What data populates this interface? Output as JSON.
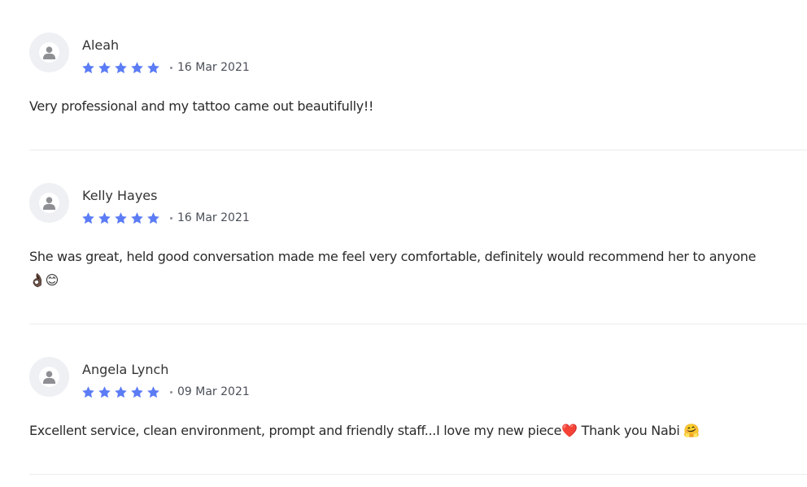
{
  "reviews": [
    {
      "name": "Aleah",
      "rating": 5,
      "date": "16 Mar 2021",
      "text": "Very professional and my tattoo came out beautifully!!",
      "emoji_line": ""
    },
    {
      "name": "Kelly Hayes",
      "rating": 5,
      "date": "16 Mar 2021",
      "text": "She was great, held good conversation made me feel very comfortable, definitely would recommend her to anyone",
      "emoji_line": "👌🏿😊"
    },
    {
      "name": "Angela Lynch",
      "rating": 5,
      "date": "09 Mar 2021",
      "text": "Excellent service, clean environment, prompt and friendly staff...I love my new piece❤️ Thank you Nabi 🤗",
      "emoji_line": ""
    }
  ],
  "colors": {
    "star": "#5b7cf5",
    "avatar_bg": "#eef0f4",
    "divider": "#ececec"
  }
}
